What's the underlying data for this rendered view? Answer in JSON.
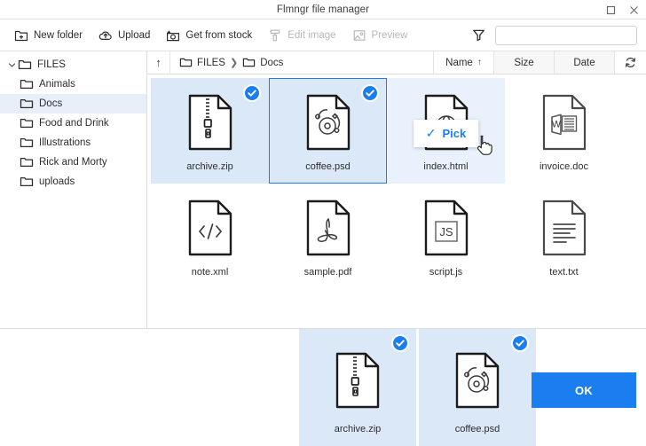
{
  "window": {
    "title": "Flmngr file manager",
    "maximize_label": "❐",
    "close_label": "✕"
  },
  "toolbar": {
    "new_folder": "New folder",
    "upload": "Upload",
    "get_from_stock": "Get from stock",
    "edit_image": "Edit image",
    "preview": "Preview",
    "search_value": "",
    "search_placeholder": ""
  },
  "sidebar": {
    "items": [
      {
        "label": "FILES",
        "level": 0,
        "expanded": true,
        "selected": false
      },
      {
        "label": "Animals",
        "level": 1,
        "expanded": false,
        "selected": false
      },
      {
        "label": "Docs",
        "level": 1,
        "expanded": false,
        "selected": true
      },
      {
        "label": "Food and Drink",
        "level": 1,
        "expanded": false,
        "selected": false
      },
      {
        "label": "Illustrations",
        "level": 1,
        "expanded": false,
        "selected": false
      },
      {
        "label": "Rick and Morty",
        "level": 1,
        "expanded": false,
        "selected": false
      },
      {
        "label": "uploads",
        "level": 1,
        "expanded": false,
        "selected": false
      }
    ]
  },
  "pathbar": {
    "up_label": "↑",
    "breadcrumbs": [
      "FILES",
      "Docs"
    ],
    "separator": "❯",
    "sort_tabs": [
      {
        "label": "Name",
        "active": true,
        "arrow": "↑"
      },
      {
        "label": "Size",
        "active": false,
        "arrow": ""
      },
      {
        "label": "Date",
        "active": false,
        "arrow": ""
      }
    ]
  },
  "files": [
    {
      "name": "archive.zip",
      "icon": "zip-file-icon",
      "selected": true,
      "focused": false,
      "hovered": false
    },
    {
      "name": "coffee.psd",
      "icon": "psd-file-icon",
      "selected": true,
      "focused": true,
      "hovered": false
    },
    {
      "name": "index.html",
      "icon": "html-file-icon",
      "selected": false,
      "focused": false,
      "hovered": true
    },
    {
      "name": "invoice.doc",
      "icon": "doc-file-icon",
      "selected": false,
      "focused": false,
      "hovered": false
    },
    {
      "name": "note.xml",
      "icon": "xml-file-icon",
      "selected": false,
      "focused": false,
      "hovered": false
    },
    {
      "name": "sample.pdf",
      "icon": "pdf-file-icon",
      "selected": false,
      "focused": false,
      "hovered": false
    },
    {
      "name": "script.js",
      "icon": "js-file-icon",
      "selected": false,
      "focused": false,
      "hovered": false
    },
    {
      "name": "text.txt",
      "icon": "txt-file-icon",
      "selected": false,
      "focused": false,
      "hovered": false
    }
  ],
  "pick_overlay": {
    "label": "Pick",
    "check": "✓"
  },
  "bottom": {
    "selected_files": [
      {
        "name": "archive.zip",
        "icon": "zip-file-icon"
      },
      {
        "name": "coffee.psd",
        "icon": "psd-file-icon"
      }
    ],
    "ok_label": "OK"
  },
  "colors": {
    "accent": "#1a7ef0",
    "selected_tile": "#dbe8f8",
    "sidebar_selected": "#e8eff9"
  }
}
